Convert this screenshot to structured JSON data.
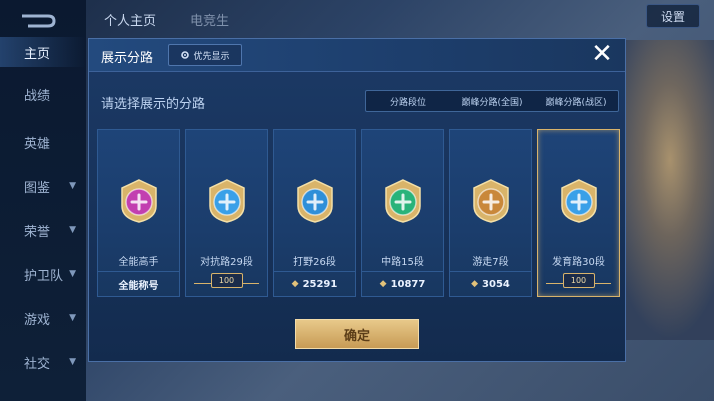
{
  "sidebar": {
    "items": [
      {
        "label": "主页",
        "active": true,
        "chevron": false
      },
      {
        "label": "战绩",
        "active": false,
        "chevron": false
      },
      {
        "label": "英雄",
        "active": false,
        "chevron": false
      },
      {
        "label": "图鉴",
        "active": false,
        "chevron": true
      },
      {
        "label": "荣誉",
        "active": false,
        "chevron": true
      },
      {
        "label": "护卫队",
        "active": false,
        "chevron": true
      },
      {
        "label": "游戏",
        "active": false,
        "chevron": true
      },
      {
        "label": "社交",
        "active": false,
        "chevron": true
      }
    ]
  },
  "topbar": {
    "tab_profile": "个人主页",
    "tab_partial": "电竞生",
    "settings": "设置"
  },
  "modal": {
    "title": "展示分路",
    "priority_button": "优先显示",
    "close": "✕",
    "prompt": "请选择展示的分路",
    "segments": [
      {
        "label": "分路段位",
        "active": true
      },
      {
        "label": "巅峰分路(全国)",
        "active": false
      },
      {
        "label": "巅峰分路(战区)",
        "active": false
      }
    ],
    "cards": [
      {
        "name": "全能高手",
        "footer_text": "全能称号",
        "footer_type": "title",
        "emblem": "all-round-emblem-icon",
        "color": "#c23fb0",
        "selected": false
      },
      {
        "name": "对抗路29段",
        "footer_text": "100",
        "footer_type": "badge",
        "emblem": "clash-lane-emblem-icon",
        "color": "#3aa0e8",
        "selected": false
      },
      {
        "name": "打野26段",
        "footer_text": "25291",
        "footer_type": "score",
        "emblem": "jungle-emblem-icon",
        "color": "#2f8fd8",
        "selected": false
      },
      {
        "name": "中路15段",
        "footer_text": "10877",
        "footer_type": "score",
        "emblem": "mid-lane-emblem-icon",
        "color": "#29b37a",
        "selected": false
      },
      {
        "name": "游走7段",
        "footer_text": "3054",
        "footer_type": "score",
        "emblem": "roam-emblem-icon",
        "color": "#c9883a",
        "selected": false
      },
      {
        "name": "发育路30段",
        "footer_text": "100",
        "footer_type": "badge",
        "emblem": "farm-lane-emblem-icon",
        "color": "#3aa0e8",
        "selected": true
      }
    ],
    "confirm": "确定"
  }
}
